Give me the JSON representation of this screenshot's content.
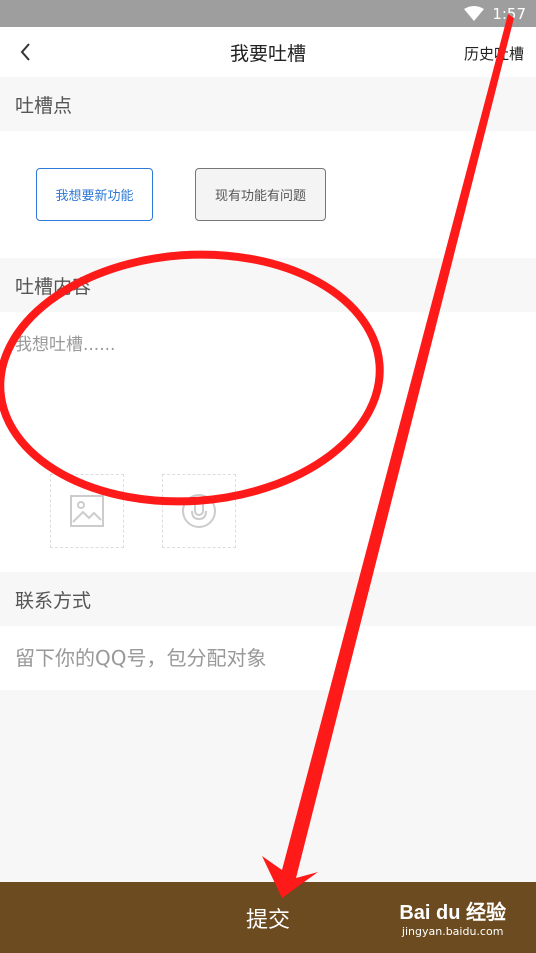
{
  "status": {
    "time": "1:57",
    "wifi_icon": "wifi-icon"
  },
  "header": {
    "title": "我要吐槽",
    "history": "历史吐槽",
    "back_icon": "chevron-left-icon"
  },
  "sections": {
    "point": {
      "label": "吐槽点",
      "options": [
        {
          "label": "我想要新功能",
          "selected": true
        },
        {
          "label": "现有功能有问题",
          "selected": false
        }
      ]
    },
    "content": {
      "label": "吐槽内容",
      "placeholder": "我想吐槽......",
      "image_icon": "image-icon",
      "voice_icon": "microphone-icon"
    },
    "contact": {
      "label": "联系方式",
      "placeholder": "留下你的QQ号，包分配对象"
    }
  },
  "submit": {
    "label": "提交"
  },
  "watermark": {
    "logo": "Bai du 经验",
    "url": "jingyan.baidu.com"
  },
  "colors": {
    "accent": "#2f7ad6",
    "submit_bg": "#6b4b1f",
    "annotation": "#ff1a1a"
  }
}
